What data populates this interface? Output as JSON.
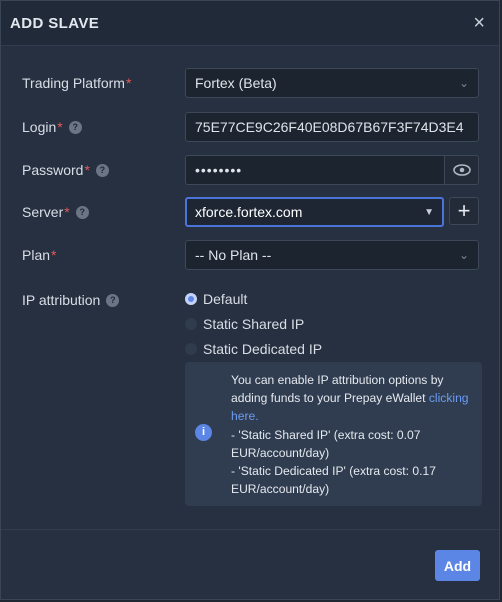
{
  "modal": {
    "title": "ADD SLAVE",
    "close": "×"
  },
  "fields": {
    "platform": {
      "label": "Trading Platform",
      "value": "Fortex (Beta)"
    },
    "login": {
      "label": "Login",
      "value": "75E77CE9C26F40E08D67B67F3F74D3E4"
    },
    "password": {
      "label": "Password",
      "value": "••••••••"
    },
    "server": {
      "label": "Server",
      "value": "xforce.fortex.com",
      "add": "+"
    },
    "plan": {
      "label": "Plan",
      "value": "-- No Plan --"
    },
    "ip": {
      "label": "IP attribution"
    }
  },
  "required_marker": "*",
  "help_glyph": "?",
  "radio_options": [
    "Default",
    "Static Shared IP",
    "Static Dedicated IP"
  ],
  "selected_radio": "Default",
  "info": {
    "text_before_link": "You can enable IP attribution options by adding funds to your Prepay eWallet ",
    "link": "clicking here.",
    "line2": "- 'Static Shared IP' (extra cost: 0.07 EUR/account/day)",
    "line3": "- 'Static Dedicated IP' (extra cost: 0.17 EUR/account/day)"
  },
  "footer": {
    "add_label": "Add"
  },
  "colors": {
    "accent": "#5b86e6",
    "required": "#e35a5a",
    "link": "#6b9bf2"
  }
}
